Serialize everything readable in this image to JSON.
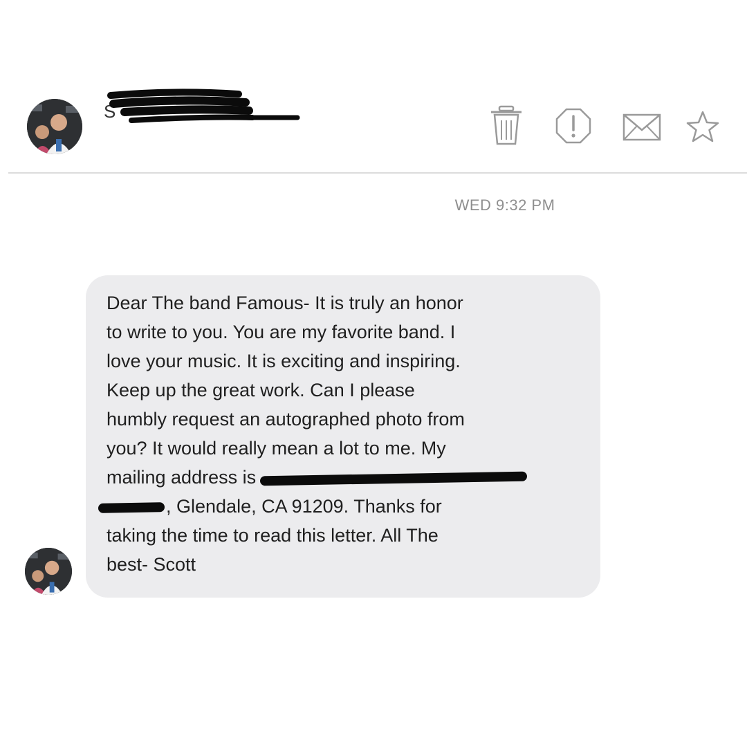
{
  "header": {
    "sender_visible": "S",
    "actions": [
      {
        "name": "trash-icon",
        "label": "Delete"
      },
      {
        "name": "report-icon",
        "label": "Report"
      },
      {
        "name": "mail-icon",
        "label": "Mark as unread"
      },
      {
        "name": "star-icon",
        "label": "Favorite"
      }
    ]
  },
  "message": {
    "timestamp": "WED 9:32 PM",
    "lines": [
      "Dear The band Famous- It is truly an honor",
      "to write to you. You are my favorite band. I",
      "love your music. It is exciting and inspiring.",
      "Keep up the great work. Can I please",
      "humbly request an autographed photo from",
      "you? It would really mean a lot to me. My",
      "mailing address is",
      ", Glendale, CA 91209. Thanks for",
      "taking the time to read this letter. All The",
      "best- Scott"
    ]
  },
  "colors": {
    "bubble": "#ececee",
    "text": "#1f1f1f",
    "timestamp": "#8f8f8f",
    "icon": "#9a9a9a",
    "redaction": "#0b0b0b"
  }
}
